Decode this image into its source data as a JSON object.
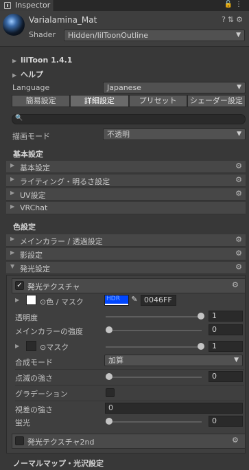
{
  "tab": {
    "label": "Inspector"
  },
  "material": {
    "name": "Varialamina_Mat",
    "shader_label": "Shader",
    "shader_value": "Hidden/lilToonOutline"
  },
  "info": {
    "version": "lilToon 1.4.1",
    "help": "ヘルプ"
  },
  "language": {
    "label": "Language",
    "value": "Japanese"
  },
  "mode_tabs": [
    "簡易設定",
    "詳細設定",
    "プリセット",
    "シェーダー設定"
  ],
  "render_mode": {
    "label": "描画モード",
    "value": "不透明"
  },
  "sections": {
    "basic": {
      "title": "基本設定",
      "items": [
        "基本設定",
        "ライティング・明るさ設定",
        "UV設定",
        "VRChat"
      ]
    },
    "color": {
      "title": "色設定",
      "items": [
        "メインカラー / 透過設定",
        "影設定",
        "発光設定"
      ]
    },
    "normal": {
      "title": "ノーマルマップ・光沢設定"
    }
  },
  "emission": {
    "texture_label": "発光テクスチャ",
    "color_label": "⊙色 / マスク",
    "hdr_label": "HDR",
    "hex": "0046FF",
    "alpha_label": "透明度",
    "alpha_value": "1",
    "main_strength_label": "メインカラーの強度",
    "main_strength_value": "0",
    "mask_label": "⊙マスク",
    "mask_value": "1",
    "blend_label": "合成モード",
    "blend_value": "加算",
    "blink_label": "点滅の強さ",
    "blink_value": "0",
    "gradation_label": "グラデーション",
    "parallax_label": "視差の強さ",
    "parallax_value": "0",
    "fluor_label": "蛍光",
    "fluor_value": "0",
    "texture2nd_label": "発光テクスチャ2nd"
  },
  "colors": {
    "emission_color": "#0046FF"
  }
}
